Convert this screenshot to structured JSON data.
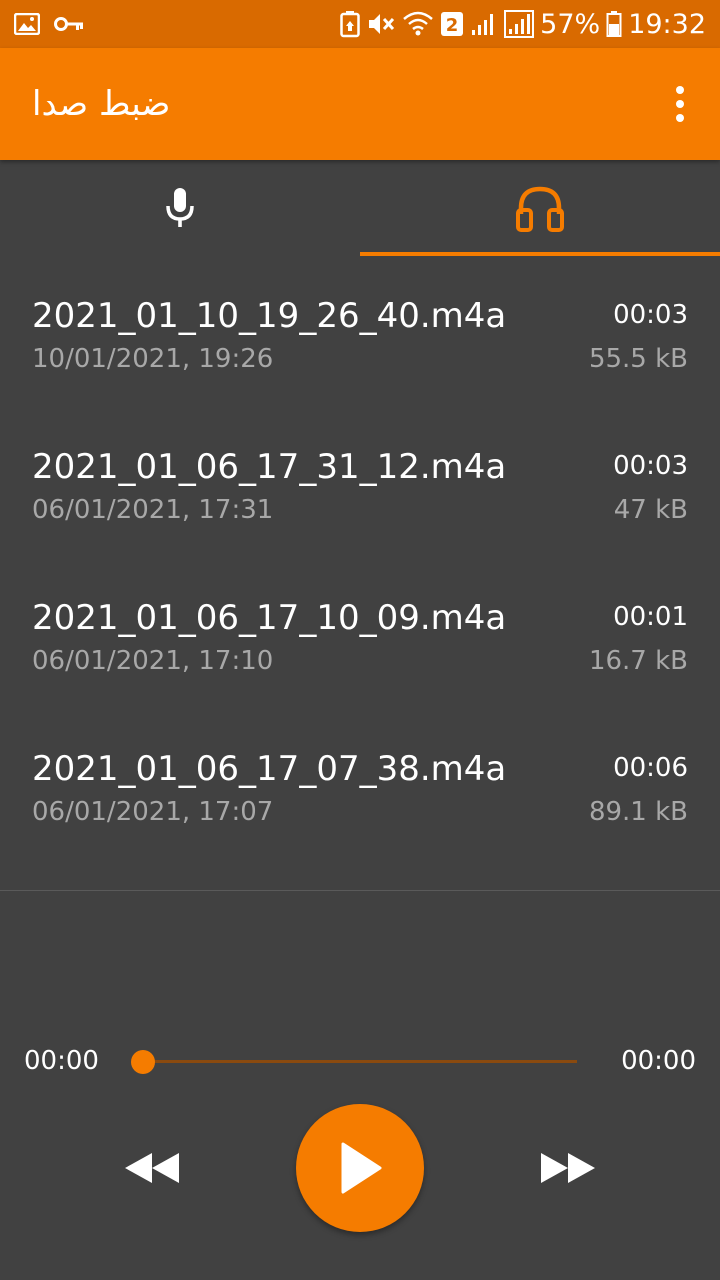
{
  "status_bar": {
    "battery": "57%",
    "time": "19:32",
    "sim_badge": "2",
    "icons": [
      "image-icon",
      "key-icon",
      "battery-saver-icon",
      "mute-icon",
      "wifi-icon",
      "signal-icon",
      "signal-icon",
      "battery-icon"
    ]
  },
  "app_bar": {
    "title": "ضبط صدا",
    "menu_icon": "overflow-menu-icon"
  },
  "tabs": [
    {
      "name": "record",
      "icon": "microphone-icon",
      "active": false
    },
    {
      "name": "recordings",
      "icon": "headphones-icon",
      "active": true
    }
  ],
  "recordings": [
    {
      "name": "2021_01_10_19_26_40.m4a",
      "date": "10/01/2021, 19:26",
      "duration": "00:03",
      "size": "55.5 kB"
    },
    {
      "name": "2021_01_06_17_31_12.m4a",
      "date": "06/01/2021, 17:31",
      "duration": "00:03",
      "size": "47 kB"
    },
    {
      "name": "2021_01_06_17_10_09.m4a",
      "date": "06/01/2021, 17:10",
      "duration": "00:01",
      "size": "16.7 kB"
    },
    {
      "name": "2021_01_06_17_07_38.m4a",
      "date": "06/01/2021, 17:07",
      "duration": "00:06",
      "size": "89.1 kB"
    }
  ],
  "player": {
    "current_time": "00:00",
    "total_time": "00:00",
    "progress": 0,
    "controls": [
      "rewind-icon",
      "play-icon",
      "fast-forward-icon"
    ]
  },
  "colors": {
    "accent": "#f57c00",
    "status_bar": "#d96a00",
    "background": "#414141",
    "secondary_text": "#a8a8a8"
  }
}
